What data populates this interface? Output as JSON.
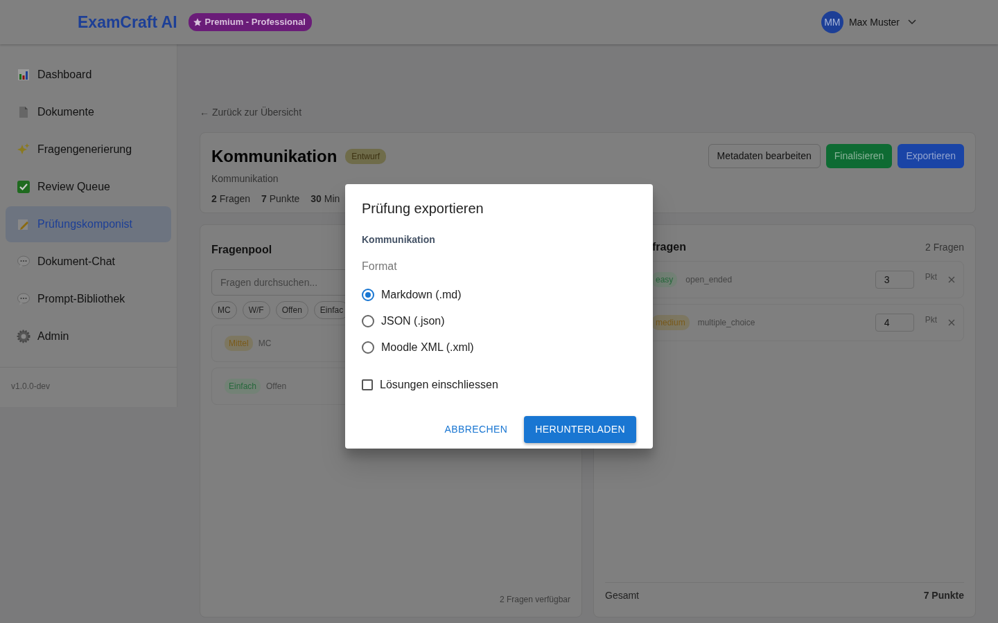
{
  "header": {
    "logo": "ExamCraft AI",
    "plan_badge": "Premium - Professional",
    "user": {
      "initials": "MM",
      "name": "Max Muster"
    }
  },
  "sidebar": {
    "items": [
      {
        "label": "Dashboard",
        "kind": "chart",
        "selected": false
      },
      {
        "label": "Dokumente",
        "kind": "document",
        "selected": false
      },
      {
        "label": "Fragengenerierung",
        "kind": "sparkles",
        "selected": false
      },
      {
        "label": "Review Queue",
        "kind": "check",
        "selected": false
      },
      {
        "label": "Prüfungskomponist",
        "kind": "memo",
        "selected": true
      },
      {
        "label": "Dokument-Chat",
        "kind": "bubble",
        "selected": false
      },
      {
        "label": "Prompt-Bibliothek",
        "kind": "bubble",
        "selected": false
      },
      {
        "label": "Admin",
        "kind": "gear",
        "selected": false
      }
    ],
    "version": "v1.0.0-dev"
  },
  "back_link": "← Zurück zur Übersicht",
  "exam": {
    "title": "Kommunikation",
    "status": "Entwurf",
    "subtitle": "Kommunikation",
    "stats": [
      "**2** Fragen",
      "**7** Punkte",
      "**30** Min"
    ],
    "actions": [
      {
        "label": "Metadaten bearbeiten",
        "kind": "outline"
      },
      {
        "label": "Finalisieren",
        "kind": "success"
      },
      {
        "label": "Exportieren",
        "kind": "primary"
      }
    ]
  },
  "pool": {
    "title": "Fragenpool",
    "search": {
      "placeholder": "Fragen durchsuchen..."
    },
    "filters": [
      {
        "label": "MC"
      },
      {
        "label": "W/F"
      },
      {
        "label": "Offen"
      },
      {
        "label": "Einfac"
      }
    ],
    "questions": [
      {
        "difficulty": "Mittel",
        "kind": "medium",
        "type": "MC"
      },
      {
        "difficulty": "Einfach",
        "kind": "easy",
        "type": "Offen"
      }
    ],
    "footer": "2 Fragen verfügbar"
  },
  "selected_questions": {
    "title": "fragen",
    "count": "2 Fragen",
    "questions": [
      {
        "difficulty": "easy",
        "kind": "easy",
        "type": "open_ended",
        "points": "3",
        "unit": "Pkt"
      },
      {
        "difficulty": "medium",
        "kind": "medium",
        "type": "multiple_choice",
        "points": "4",
        "unit": "Pkt"
      }
    ],
    "total_label": "Gesamt",
    "total": "7 Punkte"
  },
  "dialog": {
    "title": "Prüfung exportieren",
    "exam_name": "Kommunikation",
    "format_label": "Format",
    "formats": [
      {
        "label": "Markdown (.md)",
        "selected": true
      },
      {
        "label": "JSON (.json)",
        "selected": false
      },
      {
        "label": "Moodle XML (.xml)",
        "selected": false
      }
    ],
    "include_solutions": {
      "label": "Lösungen einschliessen",
      "checked": false
    },
    "buttons": [
      {
        "label": "ABBRECHEN",
        "kind": "text"
      },
      {
        "label": "HERUNTERLADEN",
        "kind": "contained"
      }
    ]
  }
}
